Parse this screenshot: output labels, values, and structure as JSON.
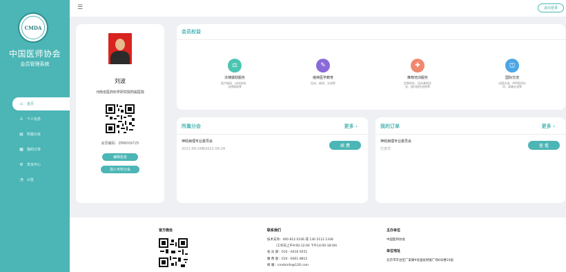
{
  "sidebar": {
    "logo_text": "CMDA",
    "title": "中国医师协会",
    "subtitle": "会员管理系统",
    "items": [
      {
        "icon": "home-icon",
        "glyph": "⌂",
        "label": "首页",
        "active": true
      },
      {
        "icon": "person-icon",
        "glyph": "♙",
        "label": "个人信息",
        "active": false
      },
      {
        "icon": "society-icon",
        "glyph": "▤",
        "label": "所属分会",
        "active": false
      },
      {
        "icon": "orders-icon",
        "glyph": "▦",
        "label": "我的订单",
        "active": false
      },
      {
        "icon": "security-icon",
        "glyph": "⚙",
        "label": "安全中心",
        "active": false
      },
      {
        "icon": "notice-icon",
        "glyph": "◔",
        "label": "公告",
        "active": false
      }
    ]
  },
  "topbar": {
    "menu_icon": "menu-icon",
    "logout_label": "退出登录"
  },
  "profile": {
    "name": "刘波",
    "organization": "河南省医药科学研究院附属医院",
    "member_id": "会员编码：ZM8009725",
    "btn_edit": "编辑信息",
    "btn_join": "加入专科分会"
  },
  "benefits": {
    "title": "会员权益",
    "items": [
      {
        "icon": "law-icon",
        "color": "#4cc4b2",
        "title": "法律援助服务",
        "desc": "医疗维权、纠纷咨询、\n法律援助等"
      },
      {
        "icon": "study-icon",
        "color": "#8a6ad8",
        "title": "继续医学教育",
        "desc": "培训、继续、交流等"
      },
      {
        "icon": "training-icon",
        "color": "#f0886f",
        "title": "推荐培训服务",
        "desc": "定期举办、培训基地优\n化、国内国外进修等"
      },
      {
        "icon": "exchange-icon",
        "color": "#4aa6e6",
        "title": "国际交流",
        "desc": "出国交流、APP医师访\n问、高端交流等"
      }
    ]
  },
  "society": {
    "title": "所属分会",
    "more": "更多 ›",
    "item_title": "神经病理专业委员会",
    "item_date": "2021-09-24到2022-09-24",
    "btn": "续 费"
  },
  "orders": {
    "title": "我的订单",
    "more": "更多 ›",
    "item_title": "神经病理专业委员会",
    "item_status": "已支付",
    "btn": "查 看"
  },
  "footer": {
    "wechat_title": "官方微信",
    "contact_title": "联系我们",
    "contact_lines": [
      "技术支持：400 812 0336 或 130 2112 1336",
      "（工作日上午9:00-12:00 下午14:00-18:00）",
      "会 员 部：010 - 6416 9251",
      "缴 费 部：010 - 6001 8812",
      "邮      箱：cmdainfo@126.com"
    ],
    "host_title": "主办单位",
    "host_name": "中国医师协会",
    "address_title": "单位地址",
    "address": "北京市丰台区广安路9号国投财富广场6号楼10层"
  }
}
